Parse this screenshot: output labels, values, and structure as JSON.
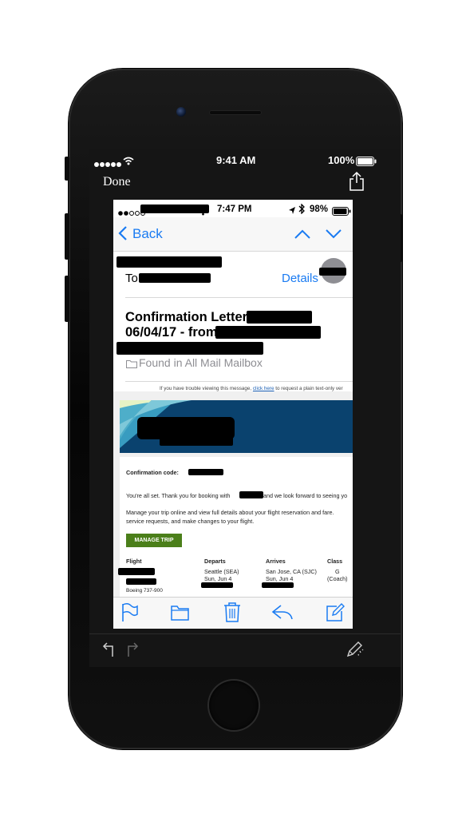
{
  "outer_status": {
    "time": "9:41 AM",
    "battery": "100%"
  },
  "outer_nav": {
    "done_label": "Done"
  },
  "inner_status": {
    "time": "7:47 PM",
    "battery": "98%"
  },
  "mail_nav": {
    "back_label": "Back"
  },
  "header": {
    "to_label": "To",
    "details_label": "Details"
  },
  "subject": {
    "line1": "Confirmation Letter",
    "line2": "06/04/17 - from"
  },
  "mailbox_text": "Found in All Mail Mailbox",
  "notice": {
    "prefix": "If you have trouble viewing this message,",
    "link": "click here",
    "suffix": "to request a plain text-only ver"
  },
  "email": {
    "confirmation_label": "Confirmation code:",
    "thanks_text_a": "You're all set. Thank you for booking with",
    "thanks_text_b": "and we look forward to seeing yo",
    "manage_text_1": "Manage your trip online and view full details about your flight reservation and fare.",
    "manage_text_2": "service requests, and make changes to your flight.",
    "manage_button": "MANAGE TRIP",
    "table_headers": {
      "flight": "Flight",
      "departs": "Departs",
      "arrives": "Arrives",
      "class": "Class"
    },
    "row": {
      "aircraft": "Boeing 737-900",
      "departs_city": "Seattle (SEA)",
      "departs_date": "Sun, Jun 4",
      "arrives_city": "San Jose, CA (SJC)",
      "arrives_date": "Sun, Jun 4",
      "class_code": "G",
      "class_name": "(Coach)"
    }
  },
  "colors": {
    "accent": "#1a7bf2",
    "manage_button": "#4b7f1a",
    "banner": "#0a426e"
  }
}
